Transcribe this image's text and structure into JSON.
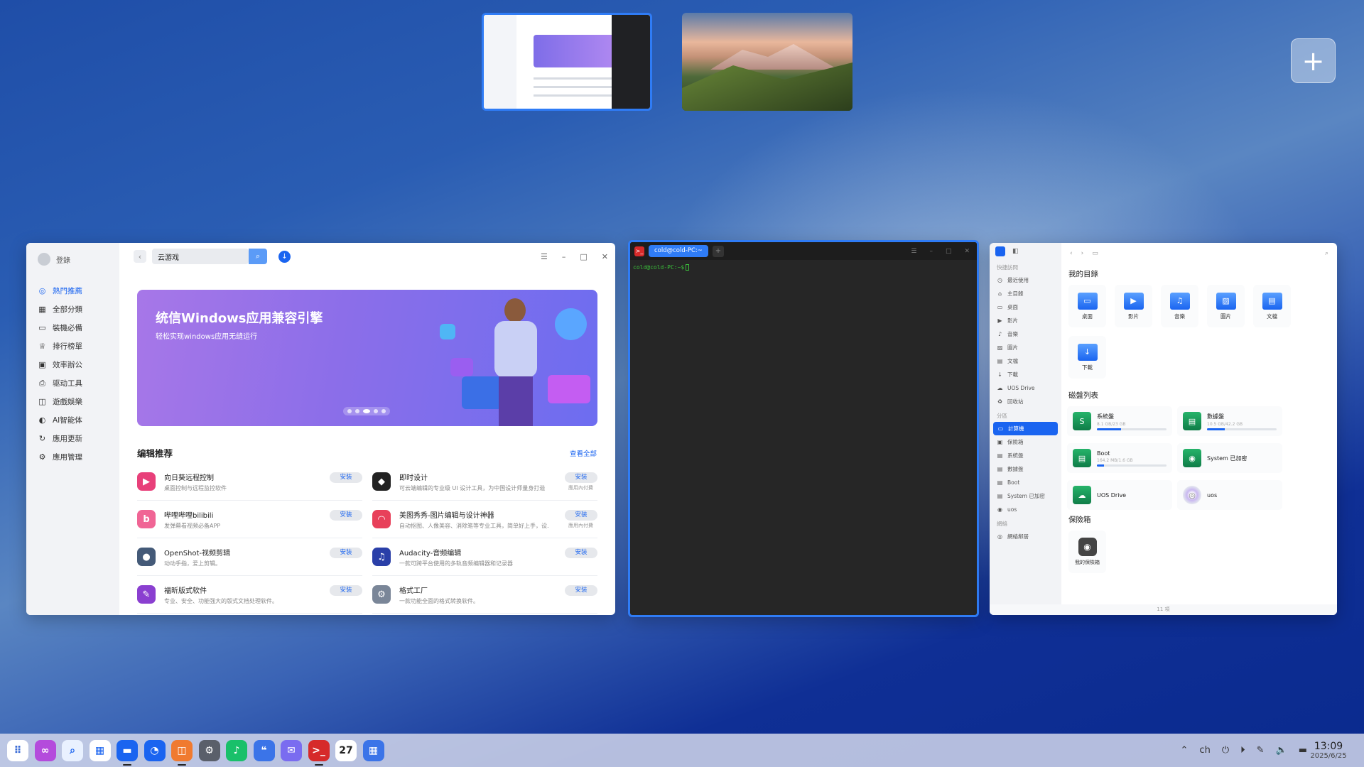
{
  "workspaces": {
    "add_label": "+"
  },
  "appstore": {
    "user": "登錄",
    "nav": [
      {
        "label": "熱門推薦",
        "icon": "compass-icon",
        "glyph": "◎",
        "active": true
      },
      {
        "label": "全部分類",
        "icon": "grid-icon",
        "glyph": "▦"
      },
      {
        "label": "裝機必備",
        "icon": "monitor-icon",
        "glyph": "▭"
      },
      {
        "label": "排行榜單",
        "icon": "trophy-icon",
        "glyph": "♕"
      },
      {
        "label": "效率辦公",
        "icon": "briefcase-icon",
        "glyph": "▣"
      },
      {
        "label": "驱动工具",
        "icon": "printer-icon",
        "glyph": "⎙"
      },
      {
        "label": "遊戲娛樂",
        "icon": "gamepad-icon",
        "glyph": "◫"
      },
      {
        "label": "AI智能体",
        "icon": "ai-icon",
        "glyph": "◐"
      },
      {
        "label": "應用更新",
        "icon": "refresh-icon",
        "glyph": "↻"
      },
      {
        "label": "應用管理",
        "icon": "settings-icon",
        "glyph": "⚙"
      }
    ],
    "search_value": "云游戏",
    "banner": {
      "title": "统信Windows应用兼容引擎",
      "subtitle": "轻松实现windows应用无缝运行"
    },
    "editor_title": "编辑推荐",
    "view_all": "查看全部",
    "apps": [
      {
        "name": "向日葵远程控制",
        "desc": "桌面控制与远程监控软件",
        "btn": "安装",
        "note": "",
        "color": "#e8407a",
        "glyph": "▶"
      },
      {
        "name": "即时设计",
        "desc": "可云端编辑的专业级 UI 设计工具，为中国设计师量身打造",
        "btn": "安装",
        "note": "應用內付費",
        "color": "#222222",
        "glyph": "◆"
      },
      {
        "name": "哔哩哔哩bilibili",
        "desc": "发弹幕看视频必备APP",
        "btn": "安装",
        "note": "",
        "color": "#f06595",
        "glyph": "b"
      },
      {
        "name": "美图秀秀-图片编辑与设计神器",
        "desc": "自动抠图、人像美容、消除笔等专业工具，简单好上手，设…",
        "btn": "安装",
        "note": "應用內付費",
        "color": "#e8405a",
        "glyph": "◠"
      },
      {
        "name": "OpenShot-视频剪辑",
        "desc": "动动手指，爱上剪辑。",
        "btn": "安装",
        "note": "",
        "color": "#445a78",
        "glyph": "●"
      },
      {
        "name": "Audacity-音频编辑",
        "desc": "一款可跨平台使用的多轨音频编辑器和记录器",
        "btn": "安装",
        "note": "",
        "color": "#2a3fa8",
        "glyph": "♫"
      },
      {
        "name": "福昕版式软件",
        "desc": "专业、安全、功能强大的版式文档处理软件。",
        "btn": "安装",
        "note": "",
        "color": "#8a3fd0",
        "glyph": "✎"
      },
      {
        "name": "格式工厂",
        "desc": "一款功能全面的格式转换软件。",
        "btn": "安装",
        "note": "",
        "color": "#7a8698",
        "glyph": "⚙"
      }
    ]
  },
  "terminal": {
    "tab": "cold@cold-PC:~",
    "prompt": "cold@cold-PC:~$"
  },
  "filemanager": {
    "quick_label": "快捷訪問",
    "quick": [
      {
        "label": "最近使用",
        "glyph": "◷"
      },
      {
        "label": "主目錄",
        "glyph": "⌂"
      },
      {
        "label": "桌面",
        "glyph": "▭"
      },
      {
        "label": "影片",
        "glyph": "▶"
      },
      {
        "label": "音樂",
        "glyph": "♪"
      },
      {
        "label": "圖片",
        "glyph": "▨"
      },
      {
        "label": "文檔",
        "glyph": "▤"
      },
      {
        "label": "下載",
        "glyph": "↓"
      },
      {
        "label": "UOS Drive",
        "glyph": "☁"
      },
      {
        "label": "回收站",
        "glyph": "♻"
      }
    ],
    "partition_label": "分區",
    "partitions": [
      {
        "label": "計算機",
        "glyph": "▭",
        "active": true
      },
      {
        "label": "保險箱",
        "glyph": "▣"
      },
      {
        "label": "系統盤",
        "glyph": "▤"
      },
      {
        "label": "數據盤",
        "glyph": "▤"
      },
      {
        "label": "Boot",
        "glyph": "▤"
      },
      {
        "label": "System 已加密",
        "glyph": "▤"
      },
      {
        "label": "uos",
        "glyph": "◉"
      }
    ],
    "network_label": "網絡",
    "network": [
      {
        "label": "網絡鄰居",
        "glyph": "◎"
      }
    ],
    "my_dirs_title": "我的目錄",
    "dirs": [
      {
        "label": "桌面",
        "glyph": "▭"
      },
      {
        "label": "影片",
        "glyph": "▶"
      },
      {
        "label": "音樂",
        "glyph": "♫"
      },
      {
        "label": "圖片",
        "glyph": "▨"
      },
      {
        "label": "文檔",
        "glyph": "▤"
      },
      {
        "label": "下載",
        "glyph": "↓"
      }
    ],
    "disks_title": "磁盤列表",
    "disks": [
      {
        "name": "系統盤",
        "sub": "8.1 GB/23 GB",
        "used": 0.35,
        "glyph": "S"
      },
      {
        "name": "數據盤",
        "sub": "10.5 GB/42.2 GB",
        "used": 0.25,
        "glyph": "▤"
      },
      {
        "name": "Boot",
        "sub": "164.2 MB/1.6 GB",
        "used": 0.1,
        "glyph": "▤"
      },
      {
        "name": "System 已加密",
        "sub": "",
        "used": null,
        "glyph": "◉"
      },
      {
        "name": "UOS Drive",
        "sub": "",
        "used": null,
        "glyph": "☁"
      },
      {
        "name": "uos",
        "sub": "",
        "used": null,
        "glyph": "◎",
        "disc": true
      }
    ],
    "vault_title": "保險箱",
    "vault_label": "我的保險箱",
    "status": "11 項"
  },
  "taskbar": {
    "apps": [
      {
        "name": "launcher",
        "color": "#ffffff",
        "glyph": "⠿",
        "fg": "#3a6bd6"
      },
      {
        "name": "ai-assistant",
        "color": "#b44bdc",
        "glyph": "∞"
      },
      {
        "name": "search",
        "color": "#e9f1ff",
        "glyph": "⌕",
        "fg": "#1a64f0"
      },
      {
        "name": "multitask",
        "color": "#ffffff",
        "glyph": "▦",
        "fg": "#1a64f0"
      },
      {
        "name": "file-manager",
        "color": "#1a64f0",
        "glyph": "▬",
        "running": true
      },
      {
        "name": "browser",
        "color": "#1a64f0",
        "glyph": "◔"
      },
      {
        "name": "app-store",
        "color": "#f07a30",
        "glyph": "◫",
        "running": true
      },
      {
        "name": "settings",
        "color": "#5a5f6a",
        "glyph": "⚙"
      },
      {
        "name": "music",
        "color": "#19c06a",
        "glyph": "♪"
      },
      {
        "name": "chat",
        "color": "#3b74e8",
        "glyph": "❝"
      },
      {
        "name": "mail",
        "color": "#7a6cf0",
        "glyph": "✉"
      },
      {
        "name": "terminal",
        "color": "#d62a2a",
        "glyph": ">_",
        "running": true
      },
      {
        "name": "calendar",
        "color": "#ffffff",
        "glyph": "27",
        "fg": "#222"
      },
      {
        "name": "calculator",
        "color": "#3b74e8",
        "glyph": "▦"
      }
    ],
    "tray": [
      {
        "name": "chevron-up-icon",
        "glyph": "⌃"
      },
      {
        "name": "input-method-icon",
        "glyph": "ch"
      },
      {
        "name": "power-icon",
        "glyph": "⏻"
      },
      {
        "name": "play-icon",
        "glyph": "⏵"
      },
      {
        "name": "pen-icon",
        "glyph": "✎"
      },
      {
        "name": "volume-icon",
        "glyph": "🔈"
      },
      {
        "name": "network-icon",
        "glyph": "▬"
      }
    ],
    "time": "13:09",
    "date": "2025/6/25"
  }
}
